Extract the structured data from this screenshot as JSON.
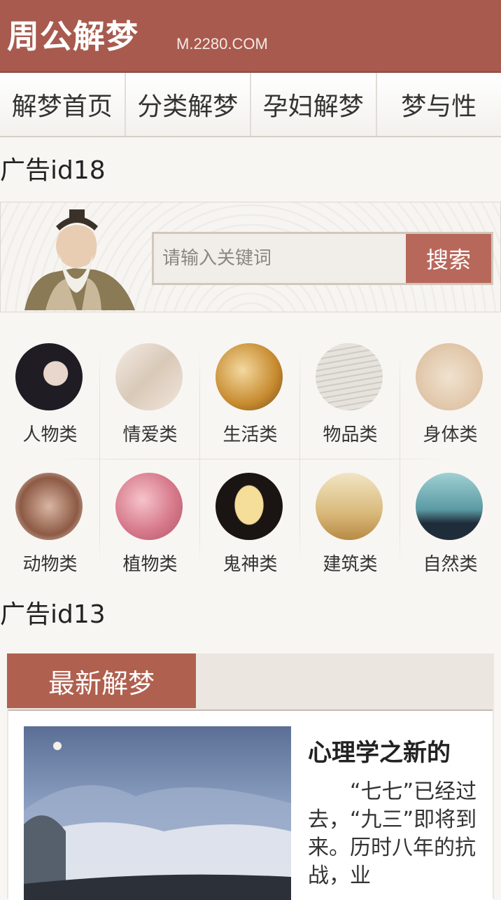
{
  "header": {
    "logo_text": "周公解梦",
    "domain": "M.2280.COM"
  },
  "nav": {
    "items": [
      {
        "label": "解梦首页"
      },
      {
        "label": "分类解梦"
      },
      {
        "label": "孕妇解梦"
      },
      {
        "label": "梦与性"
      }
    ]
  },
  "ads": {
    "top": "广告id18",
    "middle": "广告id13"
  },
  "search": {
    "placeholder": "请输入关键词",
    "button_label": "搜索"
  },
  "categories": [
    {
      "label": "人物类",
      "icon": "person-icon"
    },
    {
      "label": "情爱类",
      "icon": "love-icon"
    },
    {
      "label": "生活类",
      "icon": "life-icon"
    },
    {
      "label": "物品类",
      "icon": "object-icon"
    },
    {
      "label": "身体类",
      "icon": "body-icon"
    },
    {
      "label": "动物类",
      "icon": "animal-icon"
    },
    {
      "label": "植物类",
      "icon": "plant-icon"
    },
    {
      "label": "鬼神类",
      "icon": "ghost-icon"
    },
    {
      "label": "建筑类",
      "icon": "building-icon"
    },
    {
      "label": "自然类",
      "icon": "nature-icon"
    }
  ],
  "latest": {
    "tab_label": "最新解梦",
    "article": {
      "title": "心理学之新的",
      "excerpt": "“七七”已经过去，“九三”即将到来。历时八年的抗战，业"
    }
  },
  "colors": {
    "brand": "#a85a4e",
    "button": "#b8685b",
    "background": "#f8f6f3"
  }
}
